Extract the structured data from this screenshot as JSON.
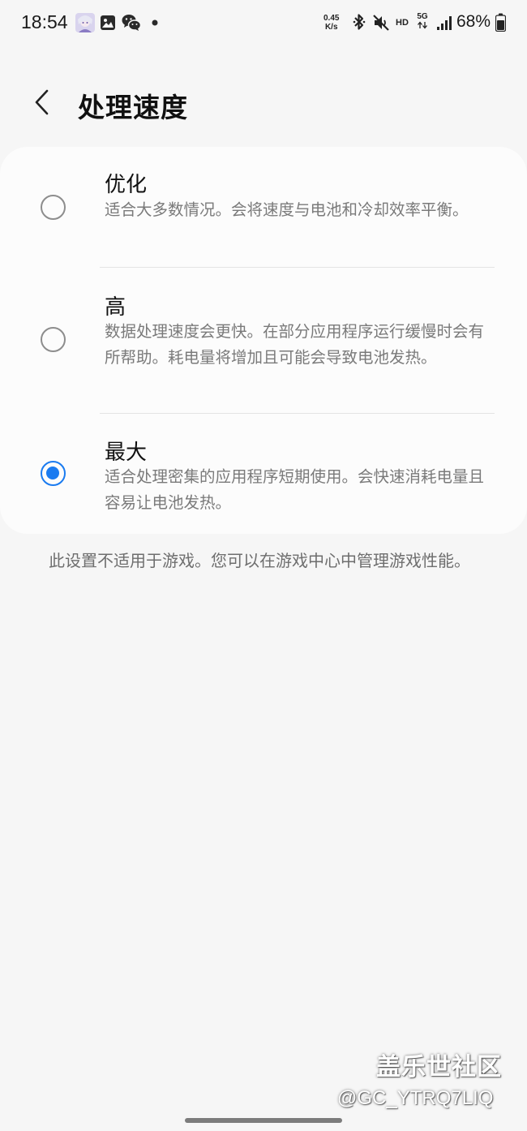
{
  "status_bar": {
    "time": "18:54",
    "net_speed_value": "0.45",
    "net_speed_unit": "K/s",
    "hd_label": "HD",
    "network_label": "5G",
    "battery_percent": "68%",
    "icons": [
      "avatar-icon",
      "gallery-icon",
      "wechat-icon",
      "dot-icon",
      "bluetooth-icon",
      "mute-icon",
      "signal-icon",
      "battery-icon"
    ]
  },
  "header": {
    "title": "处理速度"
  },
  "options": [
    {
      "title": "优化",
      "description": "适合大多数情况。会将速度与电池和冷却效率平衡。",
      "selected": false
    },
    {
      "title": "高",
      "description": "数据处理速度会更快。在部分应用程序运行缓慢时会有所帮助。耗电量将增加且可能会导致电池发热。",
      "selected": false
    },
    {
      "title": "最大",
      "description": "适合处理密集的应用程序短期使用。会快速消耗电量且容易让电池发热。",
      "selected": true
    }
  ],
  "footer_note": "此设置不适用于游戏。您可以在游戏中心中管理游戏性能。",
  "watermark": {
    "brand": "盖乐世社区",
    "user": "@GC_YTRQ7LIQ"
  },
  "colors": {
    "accent": "#1a7bf0",
    "background": "#f6f6f6",
    "card": "#fcfcfc"
  }
}
